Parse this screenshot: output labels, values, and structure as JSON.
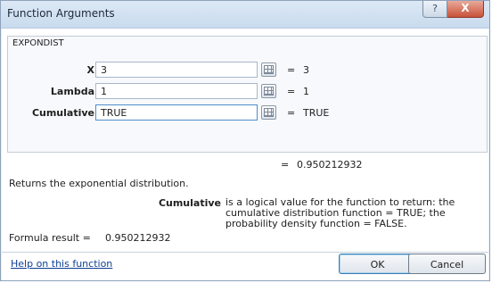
{
  "window": {
    "title": "Function Arguments",
    "help_glyph": "?",
    "close_glyph": "X"
  },
  "function_name": "EXPONDIST",
  "arguments": [
    {
      "label": "X",
      "value": "3",
      "eq": "=",
      "result": "3"
    },
    {
      "label": "Lambda",
      "value": "1",
      "eq": "=",
      "result": "1"
    },
    {
      "label": "Cumulative",
      "value": "TRUE",
      "eq": "=",
      "result": "TRUE"
    }
  ],
  "total": {
    "eq": "=",
    "value": "0.950212932"
  },
  "description": "Returns the exponential distribution.",
  "arg_help": {
    "name": "Cumulative",
    "text": "is a logical value for the function to return: the cumulative distribution function = TRUE; the probability density function = FALSE."
  },
  "formula_result": {
    "label": "Formula result =",
    "value": "0.950212932"
  },
  "help_link": "Help on this function",
  "buttons": {
    "ok": "OK",
    "cancel": "Cancel"
  },
  "icons": {
    "ref_button": "collapse-dialog-icon"
  }
}
